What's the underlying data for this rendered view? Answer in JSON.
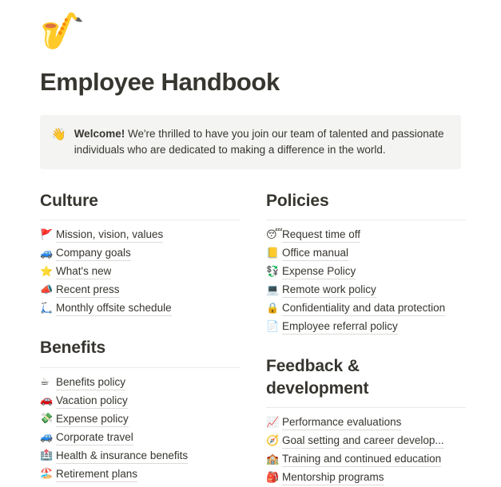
{
  "page": {
    "icon": "🎷",
    "icon_name": "saxophone-emoji",
    "title": "Employee Handbook"
  },
  "callout": {
    "icon": "👋",
    "icon_name": "waving-hand-emoji",
    "bold_prefix": "Welcome!",
    "body": " We're thrilled to have you join our team of talented and passionate individuals who are dedicated to making a difference in the world.",
    "background_color": "#f4f4f3"
  },
  "columns": {
    "left": [
      {
        "heading": "Culture",
        "items": [
          {
            "emoji": "🚩",
            "icon_name": "triangular-flag-emoji",
            "label": "Mission, vision, values"
          },
          {
            "emoji": "🚙",
            "icon_name": "sport-utility-vehicle-emoji",
            "label": "Company goals"
          },
          {
            "emoji": "⭐",
            "icon_name": "star-emoji",
            "label": "What's new"
          },
          {
            "emoji": "📣",
            "icon_name": "megaphone-emoji",
            "label": "Recent press"
          },
          {
            "emoji": "🛴",
            "icon_name": "kick-scooter-emoji",
            "label": "Monthly offsite schedule"
          }
        ]
      },
      {
        "heading": "Benefits",
        "items": [
          {
            "emoji": "☕",
            "icon_name": "hot-beverage-emoji",
            "label": "Benefits policy"
          },
          {
            "emoji": "🚗",
            "icon_name": "automobile-emoji",
            "label": "Vacation policy"
          },
          {
            "emoji": "💸",
            "icon_name": "money-with-wings-emoji",
            "label": "Expense policy"
          },
          {
            "emoji": "🚙",
            "icon_name": "sport-utility-vehicle-emoji",
            "label": "Corporate travel"
          },
          {
            "emoji": "🏥",
            "icon_name": "hospital-emoji",
            "label": "Health & insurance benefits"
          },
          {
            "emoji": "🏖️",
            "icon_name": "beach-with-umbrella-emoji",
            "label": "Retirement plans"
          }
        ]
      }
    ],
    "right": [
      {
        "heading": "Policies",
        "items": [
          {
            "emoji": "😴",
            "icon_name": "sleeping-face-emoji",
            "label": "Request time off"
          },
          {
            "emoji": "📒",
            "icon_name": "ledger-emoji",
            "label": "Office manual"
          },
          {
            "emoji": "💱",
            "icon_name": "currency-exchange-emoji",
            "label": "Expense Policy"
          },
          {
            "emoji": "💻",
            "icon_name": "laptop-emoji",
            "label": "Remote work policy"
          },
          {
            "emoji": "🔒",
            "icon_name": "locked-emoji",
            "label": "Confidentiality and data protection"
          },
          {
            "emoji": "📄",
            "icon_name": "page-facing-up-emoji",
            "label": "Employee referral policy"
          }
        ]
      },
      {
        "heading": "Feedback & development",
        "items": [
          {
            "emoji": "📈",
            "icon_name": "chart-increasing-emoji",
            "label": "Performance evaluations"
          },
          {
            "emoji": "🧭",
            "icon_name": "compass-emoji",
            "label": "Goal setting and career develop..."
          },
          {
            "emoji": "🏫",
            "icon_name": "school-emoji",
            "label": "Training and continued education"
          },
          {
            "emoji": "🎒",
            "icon_name": "backpack-emoji",
            "label": "Mentorship programs"
          }
        ]
      }
    ]
  }
}
